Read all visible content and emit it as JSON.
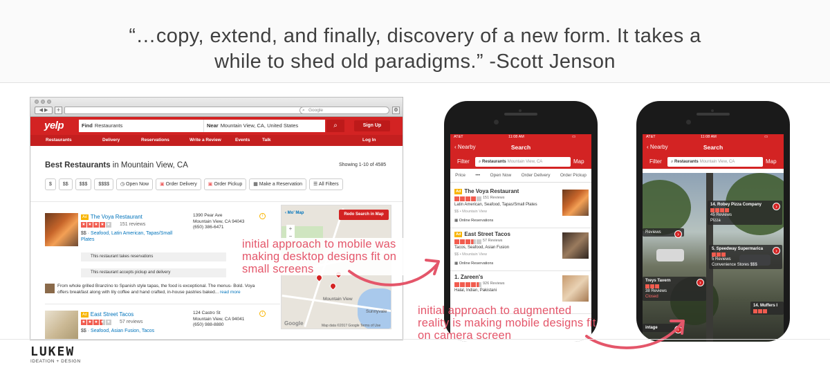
{
  "quote": {
    "line1": "“…copy, extend, and finally, discovery of a new form. It takes a",
    "line2": "while to shed old paradigms.” -Scott Jenson"
  },
  "logo": {
    "word": "LUKEW",
    "sub": "IDEATION + DESIGN"
  },
  "browser": {
    "google_placeholder": "Google",
    "yelp_logo": "yelp",
    "find_label": "Find",
    "find_value": "Restaurants",
    "near_label": "Near",
    "near_value": "Mountain View, CA, United States",
    "signup": "Sign Up",
    "nav": [
      "Restaurants",
      "Delivery",
      "Reservations",
      "Write a Review",
      "Events",
      "Talk"
    ],
    "login": "Log In",
    "heading_bold": "Best Restaurants",
    "heading_rest": " in Mountain View, CA",
    "showing": "Showing 1-10 of 4585",
    "filters": [
      "$",
      "$$",
      "$$$",
      "$$$$",
      "Open Now",
      "Order Delivery",
      "Order Pickup",
      "Make a Reservation",
      "All Filters"
    ],
    "results": [
      {
        "ad": "Ad",
        "name": "The Voya Restaurant",
        "rating": 4,
        "reviews": "151 reviews",
        "price": "$$",
        "categories": "Seafood, Latin American, Tapas/Small Plates",
        "address": [
          "1390 Pear Ave",
          "Mountain View, CA 94043",
          "(650) 386-6471"
        ],
        "notices": [
          "This restaurant takes reservations",
          "This restaurant accepts pickup and delivery"
        ],
        "snippet": "From whole grilled Branzino to Spanish style tapas, the food is exceptional. The menus- Bold. Voya offers breakfast along with lily coffee and hand crafted, in-house pastries baked...",
        "read_more": "read more"
      },
      {
        "ad": "Ad",
        "name": "East Street Tacos",
        "rating": 3.5,
        "reviews": "57 reviews",
        "price": "$$",
        "categories": "Seafood, Asian Fusion, Tacos",
        "address": [
          "124 Castro St",
          "Mountain View, CA 94041",
          "(650) 988-8880"
        ]
      }
    ],
    "map": {
      "back": "Mo' Map",
      "redo": "Redo Search in Map",
      "town": "Sunnyvale",
      "town2": "Mountain View",
      "google": "Google",
      "credit": "Map data ©2017 Google   Terms of Use"
    }
  },
  "phone_list": {
    "carrier": "AT&T",
    "time": "11:08 AM",
    "back": "Nearby",
    "title": "Search",
    "filter": "Filter",
    "map": "Map",
    "search_value": "Restaurants",
    "search_place": "Mountain View, CA",
    "chips": [
      "Price",
      "•••",
      "Open Now",
      "Order Delivery",
      "Order Pickup"
    ],
    "items": [
      {
        "ad": "Ad",
        "name": "The Voya Restaurant",
        "rating": 4,
        "reviews": "151 Reviews",
        "cats": "Latin American, Seafood, Tapas/Small Plates",
        "price": "$$  •  Mountain View",
        "extra": "Online Reservations"
      },
      {
        "ad": "Ad",
        "name": "East Street Tacos",
        "rating": 3.5,
        "reviews": "57 Reviews",
        "cats": "Tacos, Seafood, Asian Fusion",
        "price": "$$  •  Mountain View",
        "extra": "Online Reservations"
      },
      {
        "ad": "",
        "name": "1. Zareen's",
        "rating": 4.5,
        "reviews": "926 Reviews",
        "cats": "Halal, Indian, Pakistani",
        "price": "",
        "extra": ""
      }
    ]
  },
  "phone_ar": {
    "carrier": "AT&T",
    "time": "11:08 AM",
    "back": "Nearby",
    "title": "Search",
    "filter": "Filter",
    "map": "Map",
    "search_value": "Restaurants",
    "search_place": "Mountain View, CA",
    "tags": [
      {
        "name": "14. Robey Pizza Company",
        "reviews": "45 Reviews",
        "sub": "Pizza"
      },
      {
        "name": "5. Speedway Supermarica",
        "reviews": "5 Reviews",
        "sub": "Convenience Stores  $$$"
      },
      {
        "name": "Treys Tavern",
        "reviews": "38 Reviews",
        "sub": "Closed"
      },
      {
        "name": "Reviews",
        "reviews": "",
        "sub": ""
      },
      {
        "name": "14. Muffers I",
        "reviews": "",
        "sub": ""
      },
      {
        "name": "intage",
        "reviews": "",
        "sub": ""
      }
    ]
  },
  "annotations": {
    "mobile": [
      "initial approach to mobile was",
      "making desktop designs fit on",
      "small screens"
    ],
    "ar": [
      "initial approach to augmented",
      "reality is making mobile designs fit",
      "on camera screen"
    ]
  },
  "colors": {
    "yelp_red": "#d32323",
    "annotation": "#e4566a"
  }
}
